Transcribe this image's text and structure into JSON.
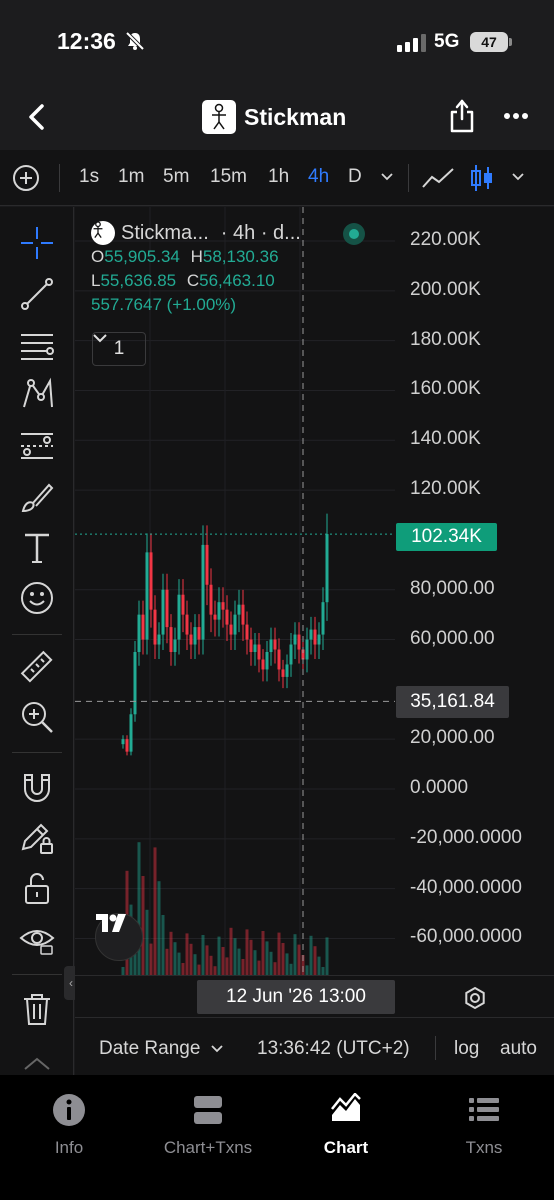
{
  "status": {
    "time": "12:36",
    "network": "5G",
    "battery": "47"
  },
  "header": {
    "title": "Stickman"
  },
  "timeframes": {
    "items": [
      "1s",
      "1m",
      "5m",
      "15m",
      "1h",
      "4h",
      "D"
    ],
    "active": "4h"
  },
  "legend": {
    "name": "Stickma...",
    "interval": "· 4h · d...",
    "o_label": "O",
    "o": "55,905.34",
    "h_label": "H",
    "h": "58,130.36",
    "l_label": "L",
    "l": "55,636.85",
    "c_label": "C",
    "c": "56,463.10",
    "change": "557.7647 (+1.00%)",
    "toggle_count": "1"
  },
  "chart_data": {
    "type": "candlestick",
    "y_axis_ticks": [
      "220.00K",
      "200.00K",
      "180.00K",
      "160.00K",
      "140.00K",
      "120.00K",
      "80,000.00",
      "60,000.00",
      "20,000.00",
      "0.0000",
      "-20,000.0000",
      "-40,000.0000",
      "-60,000.0000"
    ],
    "ylim": [
      -70000,
      228000
    ],
    "last_price_label": "102.34K",
    "last_price": 102340,
    "crosshair_price_label": "35,161.84",
    "crosshair_price": 35161.84,
    "crosshair_time_label": "12 Jun '26   13:00",
    "colors": {
      "up": "#22ab94",
      "down": "#f23645"
    },
    "ohlc_envelope": {
      "note_values": "approximate close path read from chart",
      "closes": [
        20000,
        15000,
        30000,
        55000,
        70000,
        60000,
        95000,
        72000,
        58000,
        62000,
        80000,
        65000,
        55000,
        60000,
        78000,
        70000,
        62000,
        58000,
        65000,
        60000,
        98000,
        82000,
        70000,
        68000,
        75000,
        72000,
        66000,
        62000,
        70000,
        74000,
        66000,
        60000,
        55000,
        58000,
        52000,
        48000,
        55000,
        60000,
        56000,
        48000,
        45000,
        50000,
        58000,
        62000,
        56000,
        52000,
        60000,
        64000,
        58000,
        62000,
        75000,
        102340
      ]
    }
  },
  "time_axis": {
    "crosshair_label": "12 Jun '26   13:00"
  },
  "controls": {
    "date_range": "Date Range",
    "clock": "13:36:42 (UTC+2)",
    "log": "log",
    "auto": "auto"
  },
  "tabs": [
    {
      "label": "Info",
      "icon": "info-icon"
    },
    {
      "label": "Chart+Txns",
      "icon": "split-view-icon"
    },
    {
      "label": "Chart",
      "icon": "area-chart-icon"
    },
    {
      "label": "Txns",
      "icon": "list-icon"
    }
  ]
}
